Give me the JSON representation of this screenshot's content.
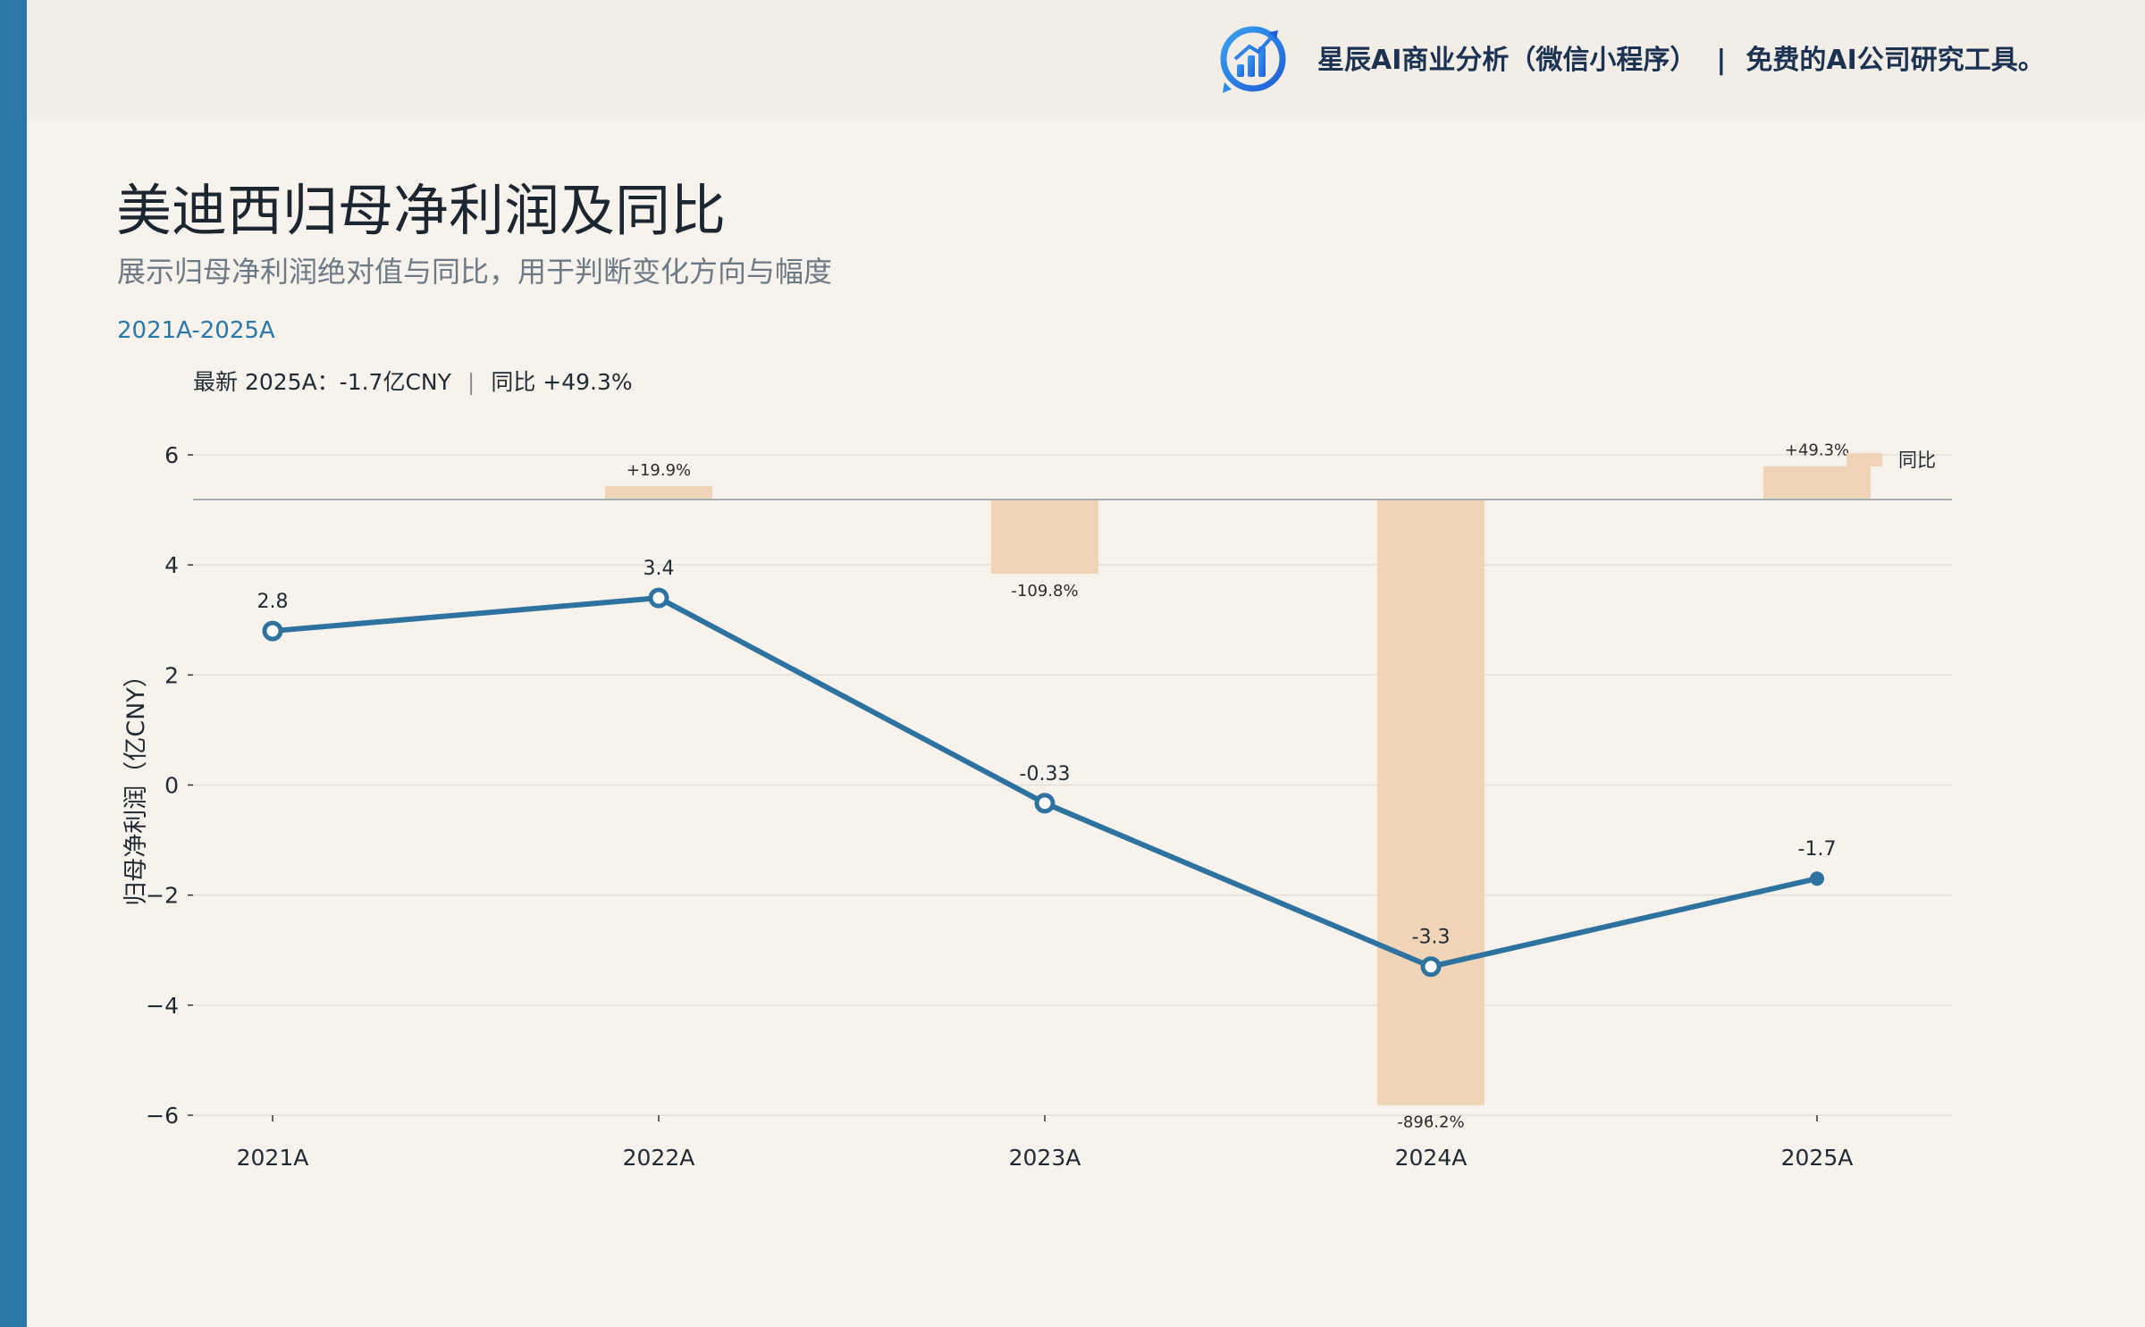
{
  "brand": {
    "name": "星辰AI商业分析（微信小程序）",
    "separator": "|",
    "tagline": "免费的AI公司研究工具。"
  },
  "title": "美迪西归母净利润及同比",
  "subtitle": "展示归母净利润绝对值与同比，用于判断变化方向与幅度",
  "period": "2021A-2025A",
  "latest": {
    "label": "最新 2025A：-1.7亿CNY",
    "separator": "|",
    "yoy": "同比 +49.3%"
  },
  "colors": {
    "accent": "#2a78a8",
    "line": "#2e73a0",
    "yoy_bar": "#efd4b8",
    "background": "#f7f3ec"
  },
  "chart_data": {
    "type": "line",
    "categories": [
      "2021A",
      "2022A",
      "2023A",
      "2024A",
      "2025A"
    ],
    "series": [
      {
        "name": "",
        "values": [
          2.8,
          3.4,
          -0.33,
          -3.3,
          -1.7
        ],
        "labels": [
          "2.8",
          "3.4",
          "-0.33",
          "-3.3",
          "-1.7"
        ]
      },
      {
        "name": "同比",
        "type": "bar",
        "values": [
          null,
          19.9,
          -109.8,
          -896.2,
          49.3
        ],
        "labels": [
          "",
          "+19.9%",
          "-109.8%",
          "-896.2%",
          "+49.3%"
        ]
      }
    ],
    "ylabel": "归母净利润（亿CNY）",
    "ylim": [
      -6,
      6
    ],
    "yticks": [
      6,
      4,
      2,
      0,
      -2,
      -4,
      -6
    ],
    "ytick_labels": [
      "6",
      "4",
      "2",
      "0",
      "−2",
      "−4",
      "−6"
    ],
    "grid": true,
    "legend": "top-right"
  }
}
